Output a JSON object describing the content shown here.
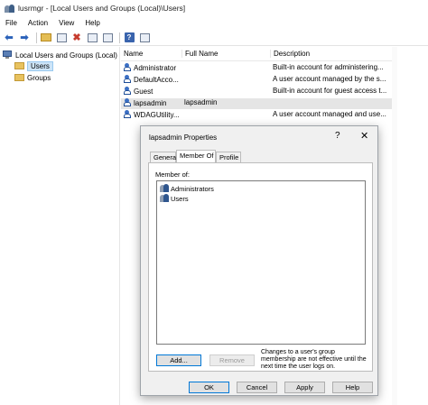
{
  "window": {
    "title": "lusrmgr - [Local Users and Groups (Local)\\Users]"
  },
  "menu": [
    "File",
    "Action",
    "View",
    "Help"
  ],
  "toolbar": {
    "icons": [
      "back-arrow-icon",
      "forward-arrow-icon",
      "up-folder-icon",
      "show-hide-tree-icon",
      "delete-icon",
      "properties-icon",
      "export-icon",
      "help-icon",
      "console-tree-icon"
    ],
    "help_glyph": "?"
  },
  "tree": {
    "root": "Local Users and Groups (Local)",
    "items": [
      "Users",
      "Groups"
    ]
  },
  "list": {
    "headers": {
      "name": "Name",
      "full_name": "Full Name",
      "description": "Description"
    },
    "rows": [
      {
        "name": "Administrator",
        "full_name": "",
        "description": "Built-in account for administering..."
      },
      {
        "name": "DefaultAcco...",
        "full_name": "",
        "description": "A user account managed by the s..."
      },
      {
        "name": "Guest",
        "full_name": "",
        "description": "Built-in account for guest access t..."
      },
      {
        "name": "lapsadmin",
        "full_name": "lapsadmin",
        "description": ""
      },
      {
        "name": "WDAGUtility...",
        "full_name": "",
        "description": "A user account managed and use..."
      }
    ]
  },
  "dialog": {
    "title": "lapsadmin Properties",
    "help_glyph": "?",
    "close_glyph": "✕",
    "tabs": [
      "General",
      "Member Of",
      "Profile"
    ],
    "member_of_label": "Member of:",
    "groups": [
      "Administrators",
      "Users"
    ],
    "add_label": "Add...",
    "remove_label": "Remove",
    "note": "Changes to a user's group membership are not effective until the next time the user logs on.",
    "ok_label": "OK",
    "cancel_label": "Cancel",
    "apply_label": "Apply",
    "help_label": "Help"
  }
}
